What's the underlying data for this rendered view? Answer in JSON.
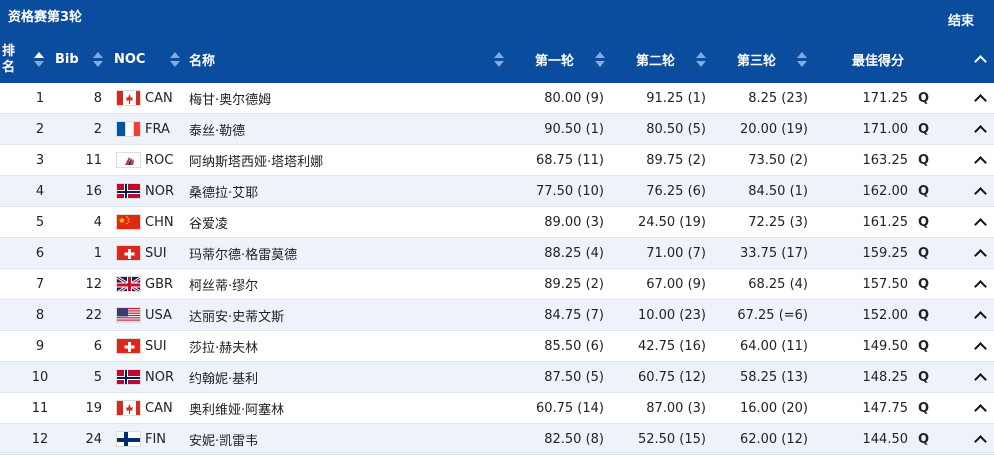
{
  "topbar": {
    "title": "资格赛第3轮",
    "end_label": "结束"
  },
  "columns": {
    "rank": "排名",
    "bib": "Bib",
    "noc": "NOC",
    "name": "名称",
    "r1": "第一轮",
    "r2": "第二轮",
    "r3": "第三轮",
    "best": "最佳得分"
  },
  "colors": {
    "header_bg": "#0a4d9e",
    "alt_row": "#eef3fb"
  },
  "rows": [
    {
      "rank": "1",
      "bib": "8",
      "noc": "CAN",
      "flag": "canada-flag",
      "name": "梅甘·奥尔德姆",
      "r1": "80.00 (9)",
      "r2": "91.25 (1)",
      "r3": "8.25 (23)",
      "best": "171.25",
      "q": "Q"
    },
    {
      "rank": "2",
      "bib": "2",
      "noc": "FRA",
      "flag": "france-flag",
      "name": "泰丝·勒德",
      "r1": "90.50 (1)",
      "r2": "80.50 (5)",
      "r3": "20.00 (19)",
      "best": "171.00",
      "q": "Q"
    },
    {
      "rank": "3",
      "bib": "11",
      "noc": "ROC",
      "flag": "roc-flag",
      "name": "阿纳斯塔西娅·塔塔利娜",
      "r1": "68.75 (11)",
      "r2": "89.75 (2)",
      "r3": "73.50 (2)",
      "best": "163.25",
      "q": "Q"
    },
    {
      "rank": "4",
      "bib": "16",
      "noc": "NOR",
      "flag": "norway-flag",
      "name": "桑德拉·艾耶",
      "r1": "77.50 (10)",
      "r2": "76.25 (6)",
      "r3": "84.50 (1)",
      "best": "162.00",
      "q": "Q"
    },
    {
      "rank": "5",
      "bib": "4",
      "noc": "CHN",
      "flag": "china-flag",
      "name": "谷爱凌",
      "r1": "89.00 (3)",
      "r2": "24.50 (19)",
      "r3": "72.25 (3)",
      "best": "161.25",
      "q": "Q"
    },
    {
      "rank": "6",
      "bib": "1",
      "noc": "SUI",
      "flag": "switzerland-flag",
      "name": "玛蒂尔德·格雷莫德",
      "r1": "88.25 (4)",
      "r2": "71.00 (7)",
      "r3": "33.75 (17)",
      "best": "159.25",
      "q": "Q"
    },
    {
      "rank": "7",
      "bib": "12",
      "noc": "GBR",
      "flag": "uk-flag",
      "name": "柯丝蒂·缪尔",
      "r1": "89.25 (2)",
      "r2": "67.00 (9)",
      "r3": "68.25 (4)",
      "best": "157.50",
      "q": "Q"
    },
    {
      "rank": "8",
      "bib": "22",
      "noc": "USA",
      "flag": "usa-flag",
      "name": "达丽安·史蒂文斯",
      "r1": "84.75 (7)",
      "r2": "10.00 (23)",
      "r3": "67.25 (=6)",
      "best": "152.00",
      "q": "Q"
    },
    {
      "rank": "9",
      "bib": "6",
      "noc": "SUI",
      "flag": "switzerland-flag",
      "name": "莎拉·赫夫林",
      "r1": "85.50 (6)",
      "r2": "42.75 (16)",
      "r3": "64.00 (11)",
      "best": "149.50",
      "q": "Q"
    },
    {
      "rank": "10",
      "bib": "5",
      "noc": "NOR",
      "flag": "norway-flag",
      "name": "约翰妮·基利",
      "r1": "87.50 (5)",
      "r2": "60.75 (12)",
      "r3": "58.25 (13)",
      "best": "148.25",
      "q": "Q"
    },
    {
      "rank": "11",
      "bib": "19",
      "noc": "CAN",
      "flag": "canada-flag",
      "name": "奥利维娅·阿塞林",
      "r1": "60.75 (14)",
      "r2": "87.00 (3)",
      "r3": "16.00 (20)",
      "best": "147.75",
      "q": "Q"
    },
    {
      "rank": "12",
      "bib": "24",
      "noc": "FIN",
      "flag": "finland-flag",
      "name": "安妮·凯雷韦",
      "r1": "82.50 (8)",
      "r2": "52.50 (15)",
      "r3": "62.00 (12)",
      "best": "144.50",
      "q": "Q"
    }
  ]
}
